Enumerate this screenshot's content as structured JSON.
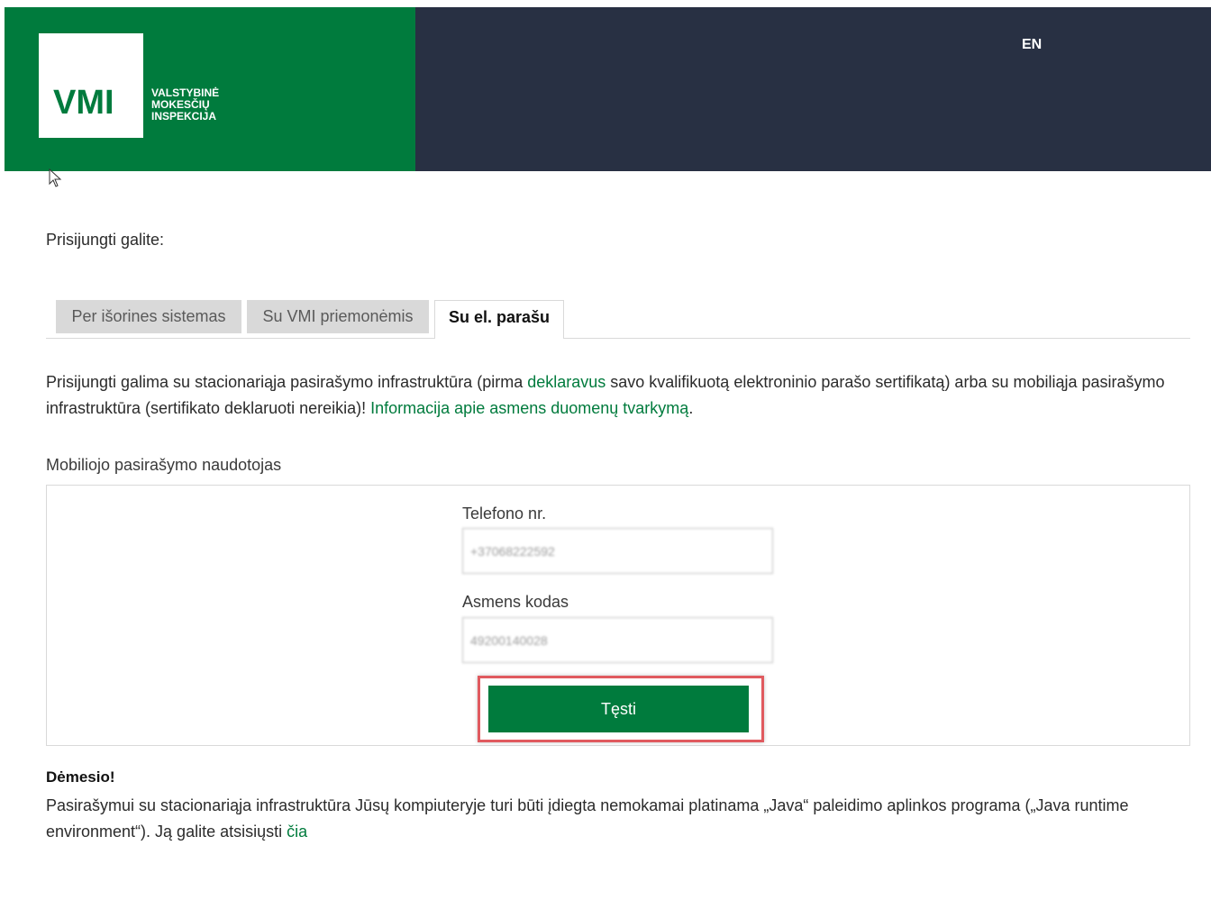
{
  "header": {
    "logo_text": "VMI",
    "logo_caption": [
      "VALSTYBINĖ",
      "MOKESČIŲ",
      "INSPEKCIJA"
    ],
    "language_link": "EN",
    "colors": {
      "brand": "#007b3d",
      "dark": "#283043"
    }
  },
  "intro": "Prisijungti galite:",
  "tabs": [
    {
      "label": "Per išorines sistemas",
      "active": false
    },
    {
      "label": "Su VMI priemonėmis",
      "active": false
    },
    {
      "label": "Su el. parašu",
      "active": true
    }
  ],
  "description": {
    "part1": "Prisijungti galima su stacionariąja pasirašymo infrastruktūra (pirma ",
    "link1": "deklaravus",
    "part2": " savo kvalifikuotą elektroninio parašo sertifikatą) arba su mobiliąja pasirašymo infrastruktūra (sertifikato deklaruoti nereikia)! ",
    "link2": "Informacija apie asmens duomenų tvarkymą",
    "part3": "."
  },
  "mobile_section": {
    "label": "Mobiliojo pasirašymo naudotojas",
    "phone_label": "Telefono nr.",
    "phone_value": "+37068222592",
    "id_label": "Asmens kodas",
    "id_value": "49200140028",
    "continue_label": "Tęsti"
  },
  "notice": {
    "title": "Dėmesio!",
    "text": "Pasirašymui su stacionariąja infrastruktūra Jūsų kompiuteryje turi būti įdiegta nemokamai platinama „Java“ paleidimo aplinkos programa („Java runtime environment“). Ją galite atsisiųsti ",
    "link": "čia"
  }
}
